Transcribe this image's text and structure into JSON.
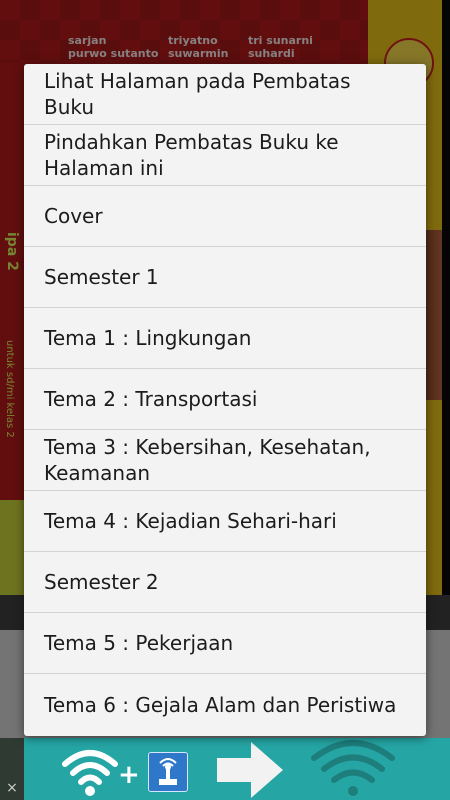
{
  "background": {
    "cover_authors": {
      "col1": [
        "sarjan",
        "purwo sutanto"
      ],
      "col2": [
        "triyatno",
        "suwarmin"
      ],
      "col3": [
        "tri sunarni",
        "suhardi"
      ]
    },
    "cover_spine_title": "ipa 2",
    "cover_spine_subtitle": "untuk sd/mi kelas 2"
  },
  "menu": {
    "items": [
      {
        "label": "Lihat Halaman pada Pembatas Buku"
      },
      {
        "label": "Pindahkan Pembatas Buku ke Halaman ini"
      },
      {
        "label": "Cover"
      },
      {
        "label": "Semester 1"
      },
      {
        "label": "Tema 1 : Lingkungan"
      },
      {
        "label": "Tema 2 : Transportasi"
      },
      {
        "label": "Tema 3 : Kebersihan, Kesehatan, Keamanan"
      },
      {
        "label": "Tema 4 : Kejadian Sehari-hari"
      },
      {
        "label": "Semester 2"
      },
      {
        "label": "Tema 5 : Pekerjaan"
      },
      {
        "label": "Tema 6 : Gejala Alam dan Peristiwa"
      }
    ]
  },
  "ad": {
    "close_glyph": "×",
    "plus_glyph": "+",
    "icons": [
      "wifi-icon",
      "router-icon",
      "arrow-right-icon",
      "wifi-icon"
    ]
  }
}
